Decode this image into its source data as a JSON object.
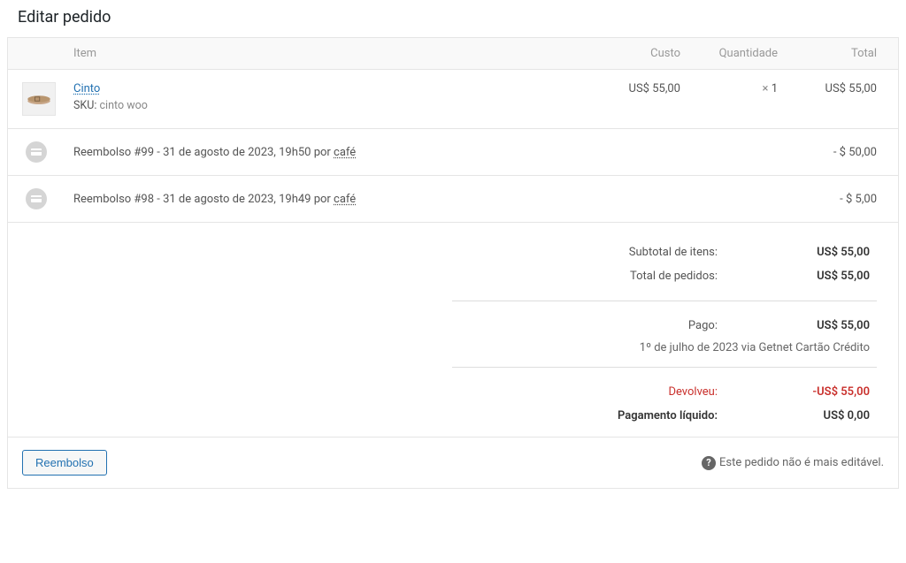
{
  "page_title": "Editar pedido",
  "headers": {
    "item": "Item",
    "cost": "Custo",
    "qty": "Quantidade",
    "total": "Total"
  },
  "product": {
    "name": "Cinto",
    "sku_label": "SKU:",
    "sku_value": "cinto woo",
    "cost": "US$ 55,00",
    "qty_prefix": "×",
    "qty": "1",
    "total": "US$ 55,00"
  },
  "refunds": [
    {
      "desc_pre": "Reembolso #99 - 31 de agosto de 2023, 19h50 por ",
      "author": "café",
      "amount": "- $ 50,00"
    },
    {
      "desc_pre": "Reembolso #98 - 31 de agosto de 2023, 19h49 por ",
      "author": "café",
      "amount": "- $ 5,00"
    }
  ],
  "totals": {
    "subtotal_label": "Subtotal de itens:",
    "subtotal_value": "US$ 55,00",
    "order_total_label": "Total de pedidos:",
    "order_total_value": "US$ 55,00",
    "paid_label": "Pago:",
    "paid_value": "US$ 55,00",
    "paid_via": "1º de julho de 2023 via Getnet Cartão Crédito",
    "refunded_label": "Devolveu:",
    "refunded_value": "US$ 55,00",
    "net_label": "Pagamento líquido:",
    "net_value": "US$ 0,00"
  },
  "footer": {
    "refund_button": "Reembolso",
    "notice": "Este pedido não é mais editável."
  }
}
